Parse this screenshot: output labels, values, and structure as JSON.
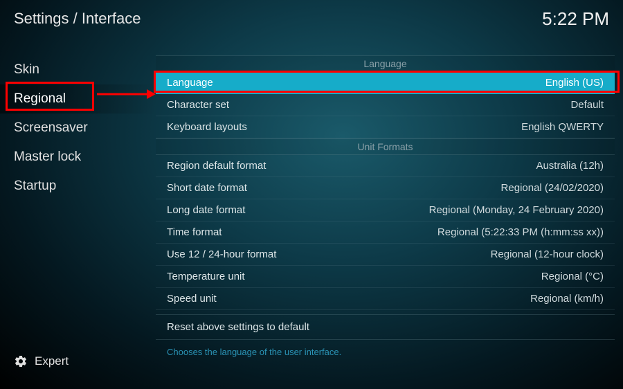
{
  "header": {
    "breadcrumb": "Settings / Interface",
    "clock": "5:22 PM"
  },
  "sidebar": {
    "items": [
      {
        "label": "Skin"
      },
      {
        "label": "Regional"
      },
      {
        "label": "Screensaver"
      },
      {
        "label": "Master lock"
      },
      {
        "label": "Startup"
      }
    ],
    "footer_label": "Expert"
  },
  "sections": [
    {
      "title": "Language",
      "rows": [
        {
          "label": "Language",
          "value": "English (US)",
          "highlighted": true
        },
        {
          "label": "Character set",
          "value": "Default"
        },
        {
          "label": "Keyboard layouts",
          "value": "English QWERTY"
        }
      ]
    },
    {
      "title": "Unit Formats",
      "rows": [
        {
          "label": "Region default format",
          "value": "Australia (12h)"
        },
        {
          "label": "Short date format",
          "value": "Regional (24/02/2020)"
        },
        {
          "label": "Long date format",
          "value": "Regional (Monday, 24 February 2020)"
        },
        {
          "label": "Time format",
          "value": "Regional (5:22:33 PM (h:mm:ss xx))"
        },
        {
          "label": "Use 12 / 24-hour format",
          "value": "Regional (12-hour clock)"
        },
        {
          "label": "Temperature unit",
          "value": "Regional (°C)"
        },
        {
          "label": "Speed unit",
          "value": "Regional (km/h)"
        }
      ]
    }
  ],
  "reset_label": "Reset above settings to default",
  "hint": "Chooses the language of the user interface."
}
